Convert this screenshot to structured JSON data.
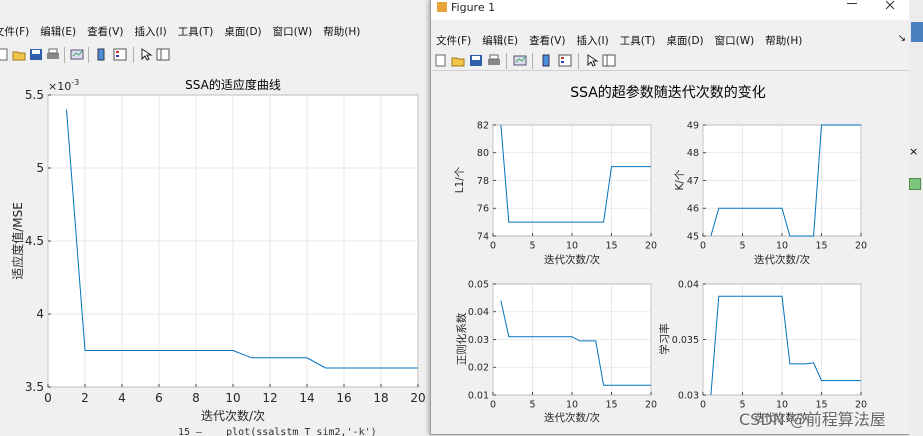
{
  "left_window": {
    "menu": [
      "文件(F)",
      "编辑(E)",
      "查看(V)",
      "插入(I)",
      "工具(T)",
      "桌面(D)",
      "窗口(W)",
      "帮助(H)"
    ],
    "plot": {
      "title": "SSA的适应度曲线",
      "xlabel": "迭代次数/次",
      "ylabel": "适应度值/MSE",
      "exponent": "×10",
      "exponent_power": "-3",
      "xticks": [
        "0",
        "2",
        "4",
        "6",
        "8",
        "10",
        "12",
        "14",
        "16",
        "18",
        "20"
      ],
      "yticks": [
        "3.5",
        "4",
        "4.5",
        "5",
        "5.5"
      ]
    },
    "code_line_number": "15 —",
    "code_text": "plot(ssalstm_T_sim2,'-k')"
  },
  "right_window": {
    "title": "Figure 1",
    "menu": [
      "文件(F)",
      "编辑(E)",
      "查看(V)",
      "插入(I)",
      "工具(T)",
      "桌面(D)",
      "窗口(W)",
      "帮助(H)"
    ],
    "menu_arrow": "↘",
    "figure_title": "SSA的超参数随迭代次数的变化",
    "subplots": {
      "l1": {
        "ylabel": "L1/个",
        "xlabel": "迭代次数/次",
        "yticks": [
          "74",
          "76",
          "78",
          "80",
          "82"
        ],
        "xticks": [
          "0",
          "5",
          "10",
          "15",
          "20"
        ]
      },
      "k": {
        "ylabel": "K/个",
        "xlabel": "迭代次数/次",
        "yticks": [
          "45",
          "46",
          "47",
          "48",
          "49"
        ],
        "xticks": [
          "0",
          "5",
          "10",
          "15",
          "20"
        ]
      },
      "reg": {
        "ylabel": "正则化系数",
        "xlabel": "迭代次数/次",
        "yticks": [
          "0.01",
          "0.02",
          "0.03",
          "0.04",
          "0.05"
        ],
        "xticks": [
          "0",
          "5",
          "10",
          "15",
          "20"
        ]
      },
      "lr": {
        "ylabel": "学习率",
        "xlabel": "迭代次数/次",
        "yticks": [
          "0.03",
          "0.035",
          "0.04"
        ],
        "xticks": [
          "0",
          "5",
          "10",
          "15",
          "20"
        ]
      }
    }
  },
  "edge_strip": {
    "close_glyph": "×"
  },
  "watermark": "CSDN @前程算法屋",
  "chart_data": [
    {
      "type": "line",
      "title": "SSA的适应度曲线",
      "xlabel": "迭代次数/次",
      "ylabel": "适应度值/MSE",
      "xlim": [
        0,
        20
      ],
      "ylim": [
        3.5,
        5.5
      ],
      "y_scale_note": "×10^-3",
      "grid": true,
      "color": "#0072bd",
      "x": [
        1,
        2,
        3,
        4,
        5,
        6,
        7,
        8,
        9,
        10,
        11,
        12,
        13,
        14,
        15,
        16,
        17,
        18,
        19,
        20
      ],
      "y": [
        5.4,
        3.75,
        3.75,
        3.75,
        3.75,
        3.75,
        3.75,
        3.75,
        3.75,
        3.75,
        3.7,
        3.7,
        3.7,
        3.7,
        3.63,
        3.63,
        3.63,
        3.63,
        3.63,
        3.63
      ]
    },
    {
      "type": "line",
      "title": "",
      "xlabel": "迭代次数/次",
      "ylabel": "L1/个",
      "xlim": [
        0,
        20
      ],
      "ylim": [
        74,
        82
      ],
      "grid": true,
      "color": "#0072bd",
      "x": [
        1,
        2,
        3,
        4,
        5,
        6,
        7,
        8,
        9,
        10,
        11,
        12,
        13,
        14,
        15,
        16,
        17,
        18,
        19,
        20
      ],
      "y": [
        82,
        75,
        75,
        75,
        75,
        75,
        75,
        75,
        75,
        75,
        75,
        75,
        75,
        75,
        79,
        79,
        79,
        79,
        79,
        79
      ]
    },
    {
      "type": "line",
      "title": "",
      "xlabel": "迭代次数/次",
      "ylabel": "K/个",
      "xlim": [
        0,
        20
      ],
      "ylim": [
        45,
        49
      ],
      "grid": true,
      "color": "#0072bd",
      "x": [
        1,
        2,
        3,
        4,
        5,
        6,
        7,
        8,
        9,
        10,
        11,
        12,
        13,
        14,
        15,
        16,
        17,
        18,
        19,
        20
      ],
      "y": [
        45,
        46,
        46,
        46,
        46,
        46,
        46,
        46,
        46,
        46,
        45,
        45,
        45,
        45,
        49,
        49,
        49,
        49,
        49,
        49
      ]
    },
    {
      "type": "line",
      "title": "",
      "xlabel": "迭代次数/次",
      "ylabel": "正则化系数",
      "xlim": [
        0,
        20
      ],
      "ylim": [
        0.01,
        0.05
      ],
      "grid": true,
      "color": "#0072bd",
      "x": [
        1,
        2,
        3,
        4,
        5,
        6,
        7,
        8,
        9,
        10,
        11,
        12,
        13,
        14,
        15,
        16,
        17,
        18,
        19,
        20
      ],
      "y": [
        0.044,
        0.031,
        0.031,
        0.031,
        0.031,
        0.031,
        0.031,
        0.031,
        0.031,
        0.031,
        0.0295,
        0.0295,
        0.0295,
        0.0135,
        0.0135,
        0.0135,
        0.0135,
        0.0135,
        0.0135,
        0.0135
      ]
    },
    {
      "type": "line",
      "title": "",
      "xlabel": "迭代次数/次",
      "ylabel": "学习率",
      "xlim": [
        0,
        20
      ],
      "ylim": [
        0.03,
        0.04
      ],
      "grid": true,
      "color": "#0072bd",
      "x": [
        1,
        2,
        3,
        4,
        5,
        6,
        7,
        8,
        9,
        10,
        11,
        12,
        13,
        14,
        15,
        16,
        17,
        18,
        19,
        20
      ],
      "y": [
        0.03,
        0.0389,
        0.0389,
        0.0389,
        0.0389,
        0.0389,
        0.0389,
        0.0389,
        0.0389,
        0.0389,
        0.0328,
        0.0328,
        0.0328,
        0.0329,
        0.0313,
        0.0313,
        0.0313,
        0.0313,
        0.0313,
        0.0313
      ]
    }
  ]
}
